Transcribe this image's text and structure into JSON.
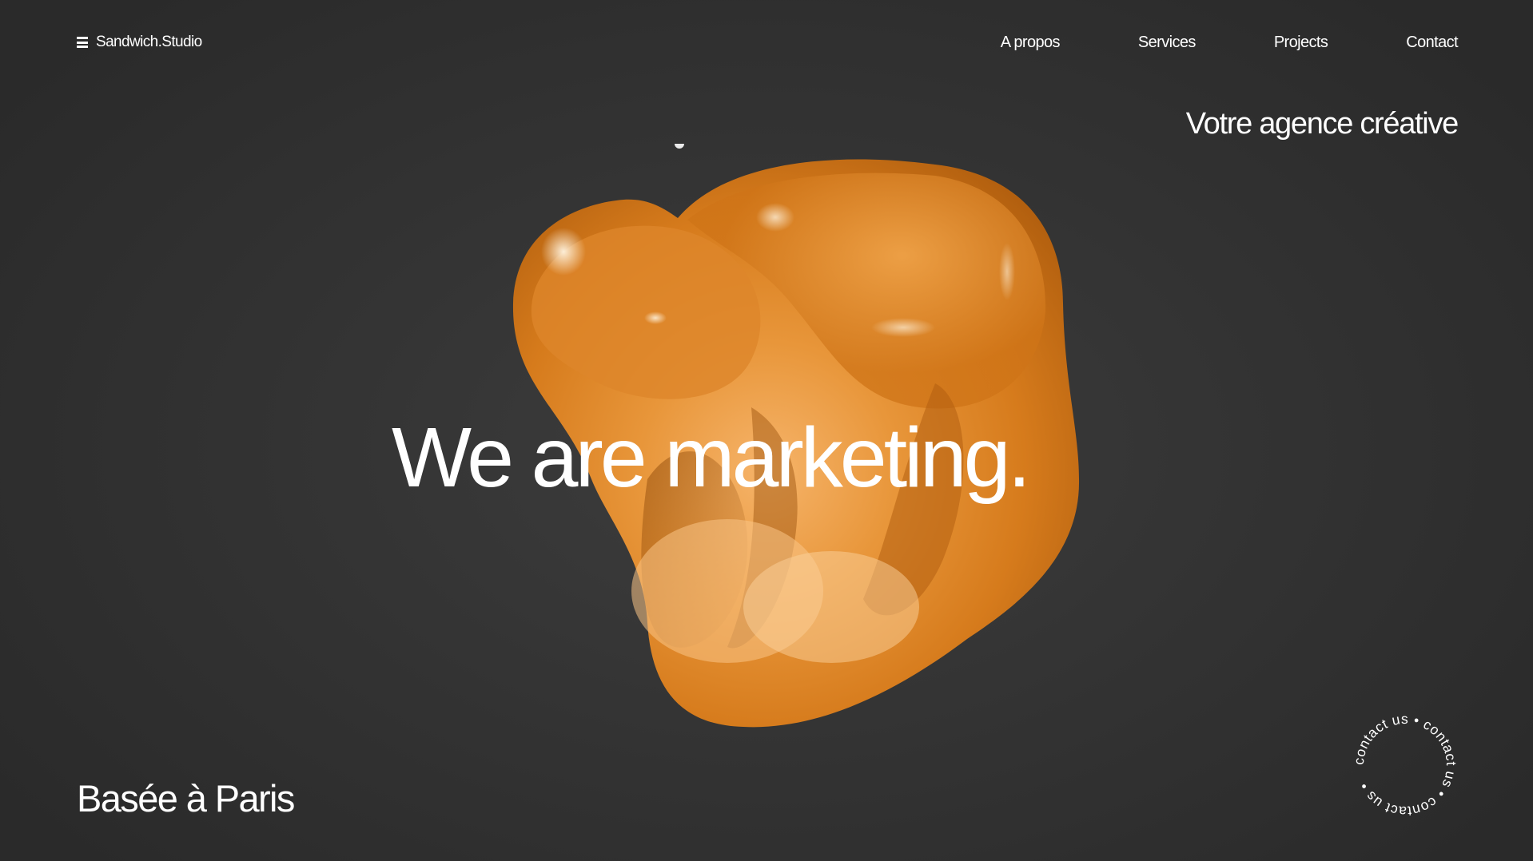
{
  "header": {
    "brand": "Sandwich.Studio",
    "nav": [
      "A propos",
      "Services",
      "Projects",
      "Contact"
    ]
  },
  "hero": {
    "tagline": "Votre agence créative",
    "headline": "We are marketing.",
    "location": "Basée à Paris"
  },
  "contact_badge": {
    "text": "contact us • contact us • contact us • "
  },
  "colors": {
    "background": "#2e2e2e",
    "text": "#ffffff",
    "blob_orange": "#e08a2c"
  },
  "icons": {
    "menu": "hamburger-menu-icon"
  }
}
